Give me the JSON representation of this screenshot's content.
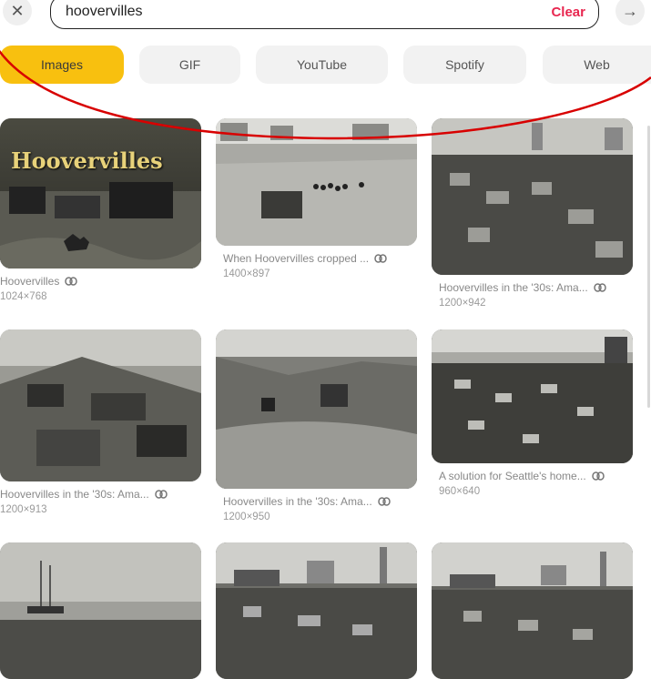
{
  "header": {
    "close_icon": "close-icon",
    "search_value": "hoovervilles",
    "clear_label": "Clear",
    "submit_icon": "arrow-right-icon"
  },
  "tabs": [
    {
      "label": "Images",
      "active": true
    },
    {
      "label": "GIF",
      "active": false
    },
    {
      "label": "YouTube",
      "active": false
    },
    {
      "label": "Spotify",
      "active": false
    },
    {
      "label": "Web",
      "active": false
    }
  ],
  "results": [
    {
      "caption": "Hoovervilles",
      "dims": "1024×768",
      "overlay_text": "Hoovervilles"
    },
    {
      "caption": "When Hoovervilles cropped ...",
      "dims": "1400×897"
    },
    {
      "caption": "Hoovervilles in the '30s: Ama...",
      "dims": "1200×942"
    },
    {
      "caption": "Hoovervilles in the '30s: Ama...",
      "dims": "1200×913"
    },
    {
      "caption": "Hoovervilles in the '30s: Ama...",
      "dims": "1200×950"
    },
    {
      "caption": "A solution for Seattle's home...",
      "dims": "960×640"
    },
    {
      "caption": "",
      "dims": ""
    },
    {
      "caption": "",
      "dims": ""
    },
    {
      "caption": "",
      "dims": ""
    }
  ],
  "colors": {
    "accent": "#f8c00f",
    "clear": "#e8264f",
    "annotation": "#d80000"
  }
}
